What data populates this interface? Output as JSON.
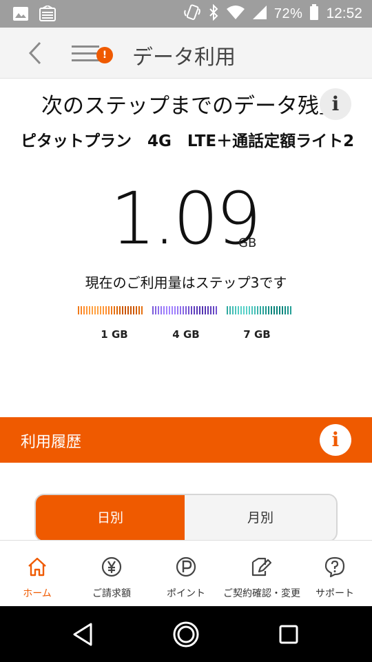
{
  "status_bar": {
    "battery": "72%",
    "time": "12:52",
    "icons": [
      "image-icon",
      "screen-cast-icon",
      "vibrate-icon",
      "bluetooth-icon",
      "wifi-icon",
      "signal-icon",
      "battery-icon"
    ]
  },
  "header": {
    "title": "データ利用",
    "menu_badge": "!"
  },
  "remaining": {
    "title": "次のステップまでのデータ残量",
    "info": "i",
    "plan_name": "ピタットプラン　4G　LTE＋通話定額ライト2",
    "value": "1.09",
    "unit": "GB",
    "current_step_text": "現在のご利用量はステップ3です",
    "steps": [
      {
        "label": "1 GB",
        "color": "#f07a1a"
      },
      {
        "label": "4 GB",
        "color": "#7a5ad8"
      },
      {
        "label": "7 GB",
        "color": "#2fa9a0"
      }
    ]
  },
  "history": {
    "title": "利用履歴",
    "info": "i",
    "tabs": [
      {
        "label": "日別",
        "active": true
      },
      {
        "label": "月別",
        "active": false
      }
    ]
  },
  "bottom_nav": [
    {
      "label": "ホーム",
      "icon": "home-icon",
      "active": true
    },
    {
      "label": "ご請求額",
      "icon": "yen-icon",
      "active": false
    },
    {
      "label": "ポイント",
      "icon": "point-icon",
      "active": false
    },
    {
      "label": "ご契約確認・変更",
      "icon": "contract-edit-icon",
      "active": false
    },
    {
      "label": "サポート",
      "icon": "help-icon",
      "active": false
    }
  ],
  "colors": {
    "accent": "#ef5a00",
    "status_bar": "#9e9e9e",
    "header_bg": "#f4f4f4"
  }
}
